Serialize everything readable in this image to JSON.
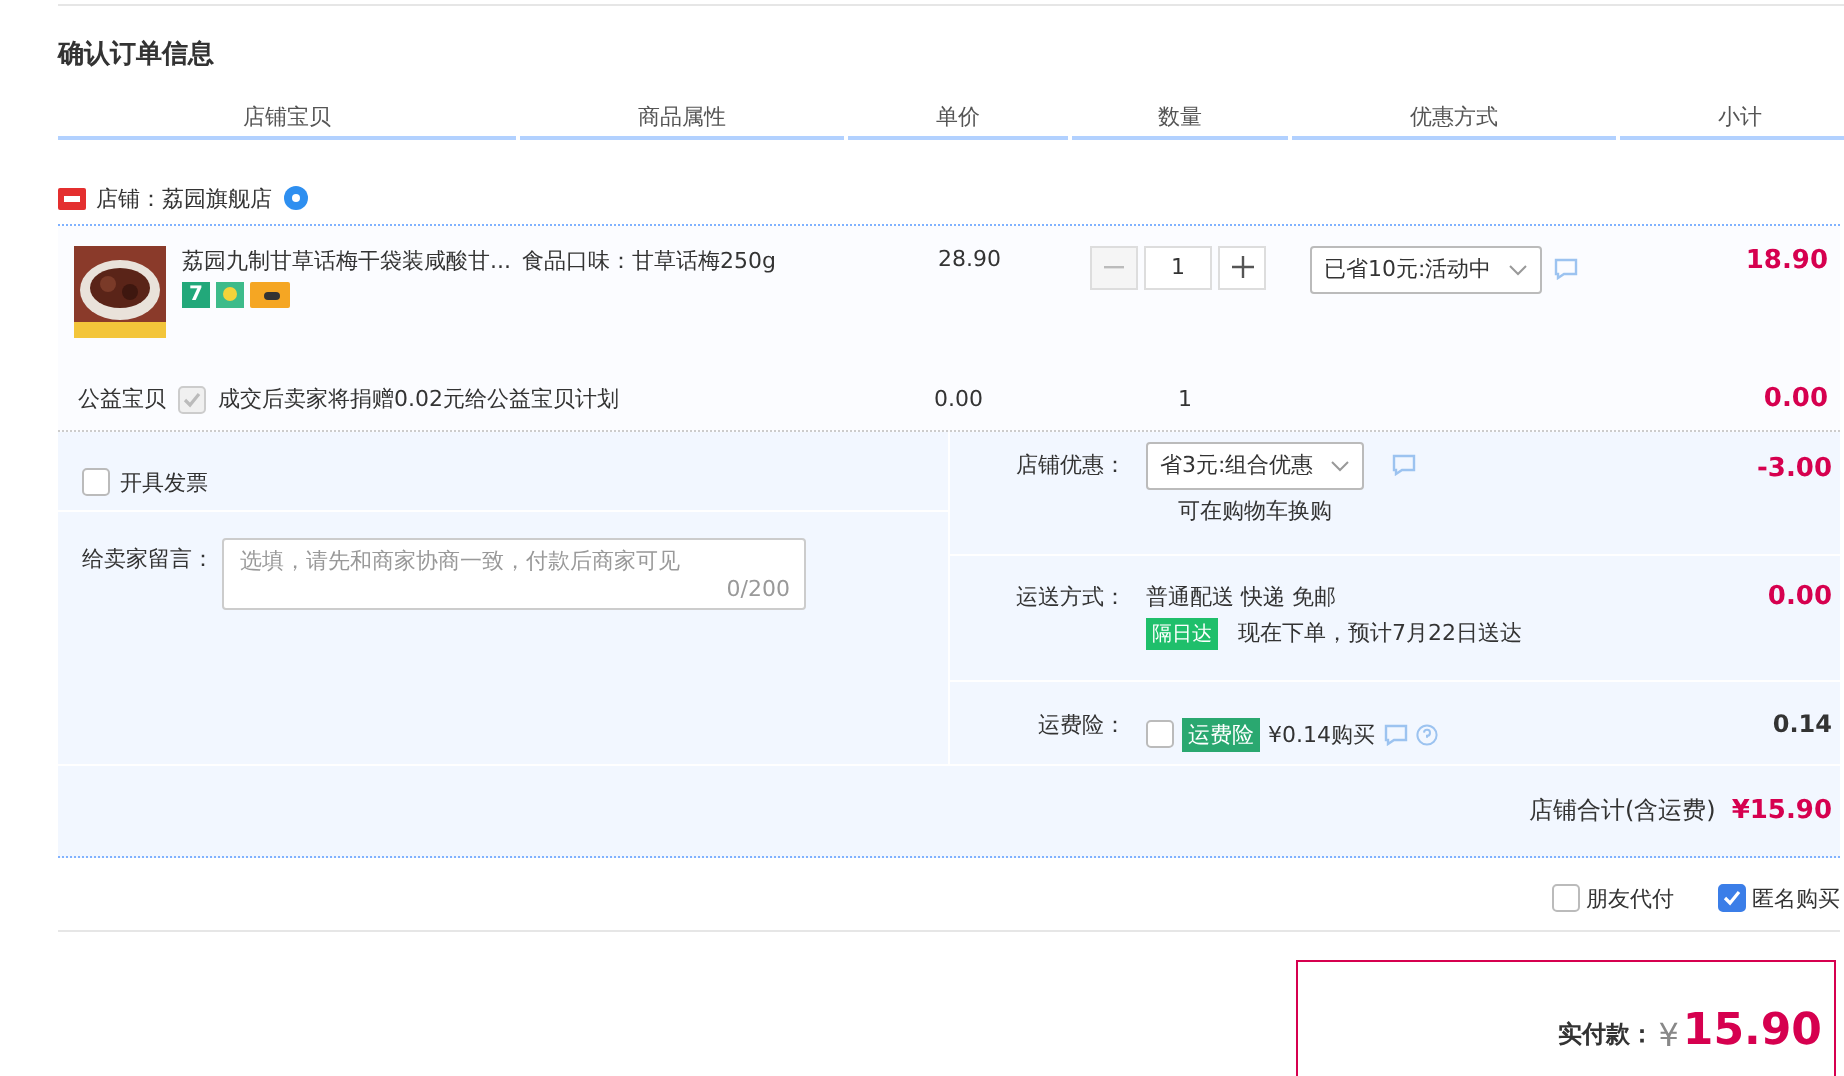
{
  "title": "确认订单信息",
  "columns": [
    "店铺宝贝",
    "商品属性",
    "单价",
    "数量",
    "优惠方式",
    "小计"
  ],
  "shop": {
    "name": "店铺：荔园旗舰店"
  },
  "item": {
    "kind": "picture",
    "title": "荔园九制甘草话梅干袋装咸酸甘...",
    "tags": [
      {
        "kind": "seven",
        "label": "7"
      },
      {
        "kind": "flower"
      },
      {
        "kind": "card"
      }
    ],
    "attribute": "食品口味：甘草话梅250g",
    "price": "28.90",
    "quantity": "1",
    "promo": "已省10元:活动中",
    "subtotal": "18.90"
  },
  "charity": {
    "label": "公益宝贝",
    "checked": true,
    "text": "成交后卖家将捐赠0.02元给公益宝贝计划",
    "price": "0.00",
    "quantity": "1",
    "subtotal": "0.00"
  },
  "invoice": {
    "label": "开具发票",
    "checked": false
  },
  "message": {
    "label": "给卖家留言：",
    "placeholder": "选填，请先和商家协商一致，付款后商家可见",
    "counter": "0/200"
  },
  "discount": {
    "label": "店铺优惠：",
    "select": "省3元:组合优惠",
    "note": "可在购物车换购",
    "amount": "-3.00"
  },
  "shipping": {
    "label": "运送方式：",
    "method": "普通配送 快递 免邮",
    "badge": "隔日达",
    "eta": "现在下单，预计7月22日送达",
    "amount": "0.00"
  },
  "insurance": {
    "label": "运费险：",
    "checked": false,
    "badge": "运费险",
    "price": "¥0.14购买",
    "amount": "0.14"
  },
  "shop_total": {
    "label": "店铺合计(含运费)",
    "amount": "¥15.90"
  },
  "options": [
    {
      "label": "朋友代付",
      "checked": false
    },
    {
      "label": "匿名购买",
      "checked": true
    }
  ],
  "payment": {
    "label": "实付款：",
    "currency": "¥",
    "amount": "15.90"
  }
}
